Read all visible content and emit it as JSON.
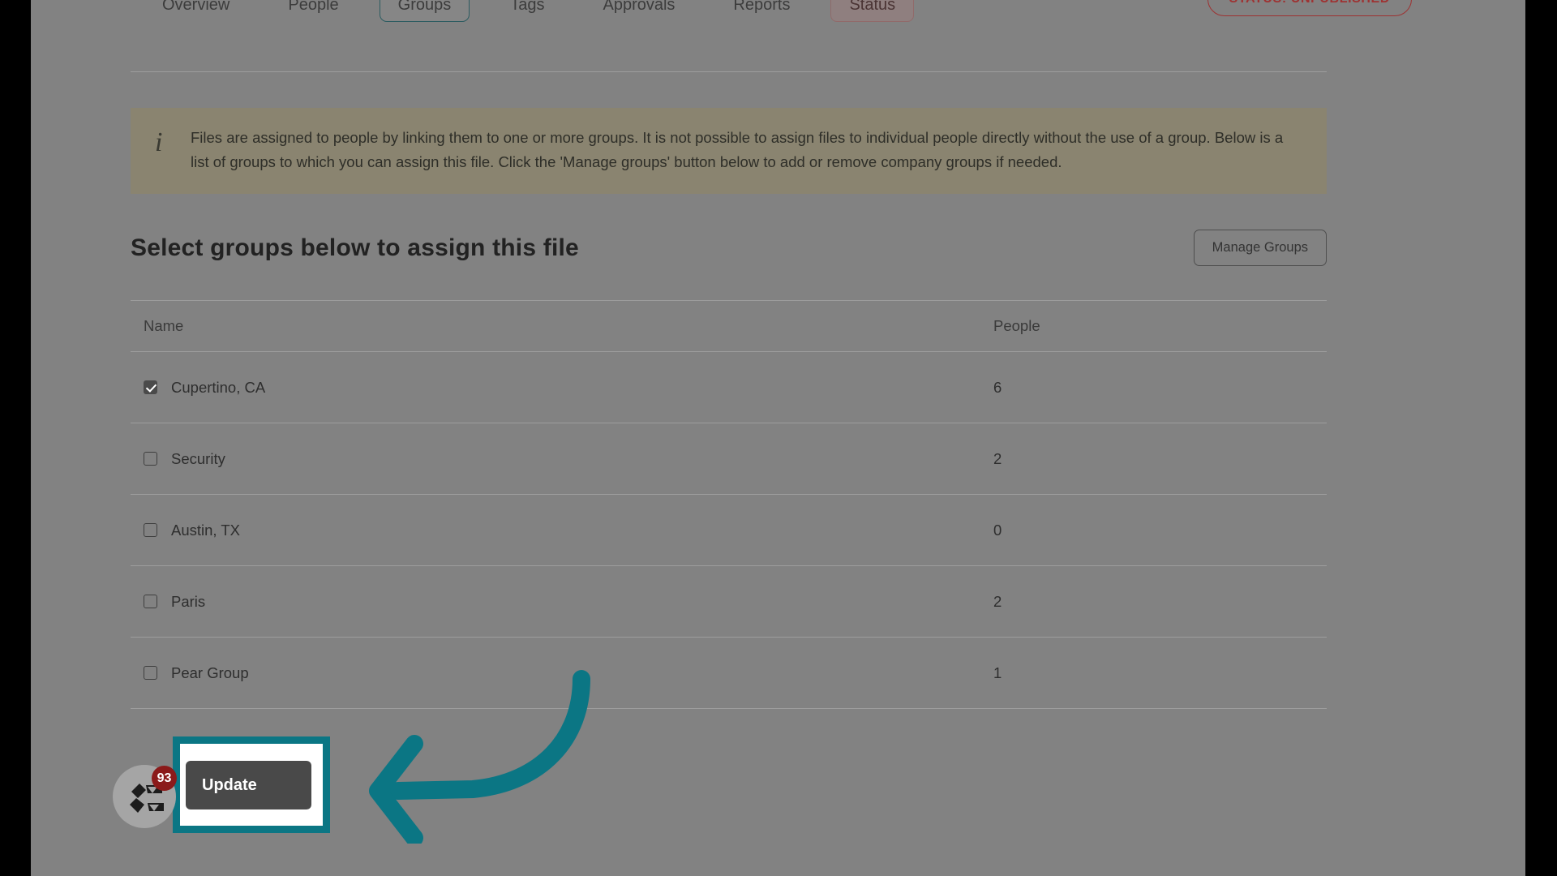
{
  "tabs": [
    {
      "label": "Overview",
      "active": false
    },
    {
      "label": "People",
      "active": false
    },
    {
      "label": "Groups",
      "active": true
    },
    {
      "label": "Tags",
      "active": false
    },
    {
      "label": "Approvals",
      "active": false
    },
    {
      "label": "Reports",
      "active": false
    },
    {
      "label": "Status",
      "active": false
    }
  ],
  "status_badge": "STATUS: UNPUBLISHED",
  "banner": {
    "icon": "info-icon",
    "text": "Files are assigned to people by linking them to one or more groups. It is not possible to assign files to individual people directly without the use of a group. Below is a list of groups to which you can assign this file. Click the 'Manage groups' button below to add or remove company groups if needed."
  },
  "section": {
    "title": "Select groups below to assign this file",
    "manage_button": "Manage Groups"
  },
  "table": {
    "columns": [
      "Name",
      "People"
    ],
    "rows": [
      {
        "name": "Cupertino, CA",
        "people": "6",
        "checked": true
      },
      {
        "name": "Security",
        "people": "2",
        "checked": false
      },
      {
        "name": "Austin, TX",
        "people": "0",
        "checked": false
      },
      {
        "name": "Paris",
        "people": "2",
        "checked": false
      },
      {
        "name": "Pear Group",
        "people": "1",
        "checked": false
      }
    ]
  },
  "actions": {
    "update_button": "Update"
  },
  "widget": {
    "badge_count": "93"
  },
  "colors": {
    "accent_teal": "#0b7684",
    "banner_bg": "#8a8470",
    "status_red": "#9e3232",
    "badge_red": "#8b1a1a",
    "page_bg": "#828282",
    "button_dark": "#494949"
  }
}
